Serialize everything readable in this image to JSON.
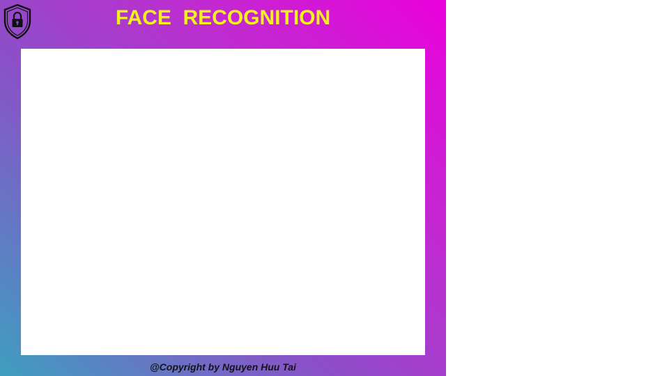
{
  "app": {
    "title": "FACE  RECOGNITION",
    "logo_icon": "shield-lock-icon",
    "footer": "@Copyright by Nguyen Huu Tai"
  },
  "colors": {
    "title": "#f2f21a",
    "gradient_start": "#3e9fc0",
    "gradient_end": "#ea00dc",
    "camera_background": "#ffffff"
  }
}
